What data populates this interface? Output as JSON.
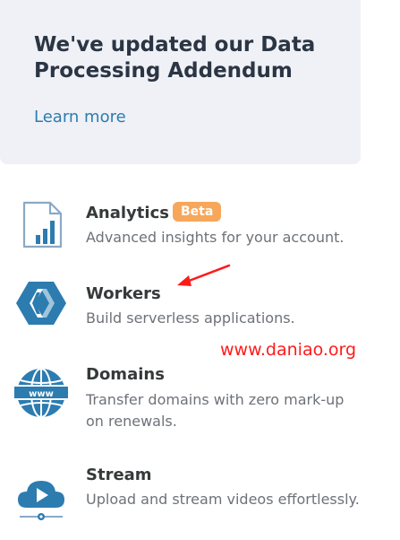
{
  "banner": {
    "title": "We've updated our Data Processing Addendum",
    "link": "Learn more"
  },
  "products": [
    {
      "title": "Analytics",
      "badge": "Beta",
      "description": "Advanced insights for your account.",
      "icon": "analytics-icon"
    },
    {
      "title": "Workers",
      "description": "Build serverless applications.",
      "icon": "workers-icon"
    },
    {
      "title": "Domains",
      "description": "Transfer domains with zero mark-up on renewals.",
      "icon": "domains-globe-icon",
      "icon_text": "www"
    },
    {
      "title": "Stream",
      "description": "Upload and stream videos effortlessly.",
      "icon": "stream-cloud-icon"
    }
  ],
  "watermark": "www.daniao.org",
  "colors": {
    "banner_bg": "#eff1f6",
    "link": "#2c7cb0",
    "icon_blue": "#2c7cb0",
    "badge": "#f6a75b",
    "annotation_red": "#ff1a1a"
  }
}
